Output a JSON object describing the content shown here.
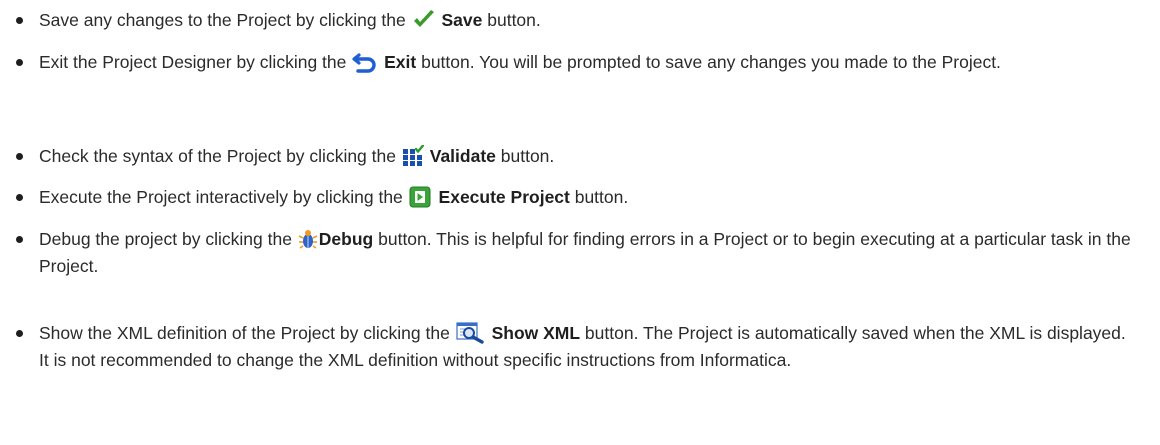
{
  "items": [
    {
      "before": "Save any changes to the Project by clicking the",
      "icon": "checkmark-icon",
      "button": "Save",
      "after": " button."
    },
    {
      "before": "Exit the Project Designer by clicking the",
      "icon": "undo-arrow-icon",
      "button": "Exit",
      "after": " button. You will be prompted to save any changes you made to the Project."
    },
    {
      "before": "Check the syntax of the Project by clicking the",
      "icon": "validate-grid-icon",
      "button": "Validate",
      "after": " button."
    },
    {
      "before": "Execute the Project interactively by clicking the",
      "icon": "execute-play-icon",
      "button": "Execute Project",
      "after": " button."
    },
    {
      "before": "Debug the project by clicking the",
      "icon": "bug-icon",
      "button": "Debug",
      "after": " button. This is helpful for finding errors in a Project or to begin executing at a particular task in the Project."
    },
    {
      "before": "Show the XML definition of the Project by clicking the",
      "icon": "xml-magnifier-icon",
      "button": "Show XML",
      "after": " button. The Project is automatically saved when the XML is displayed. It is not recommended to change the XML definition without specific instructions from Informatica."
    }
  ],
  "colors": {
    "text": "#2b2b2b",
    "check_green": "#3a9a2a",
    "exit_blue": "#1f5fd1",
    "validate_blue": "#1a4fb0",
    "execute_green": "#3aa33a",
    "debug_blue": "#2d64c8"
  }
}
